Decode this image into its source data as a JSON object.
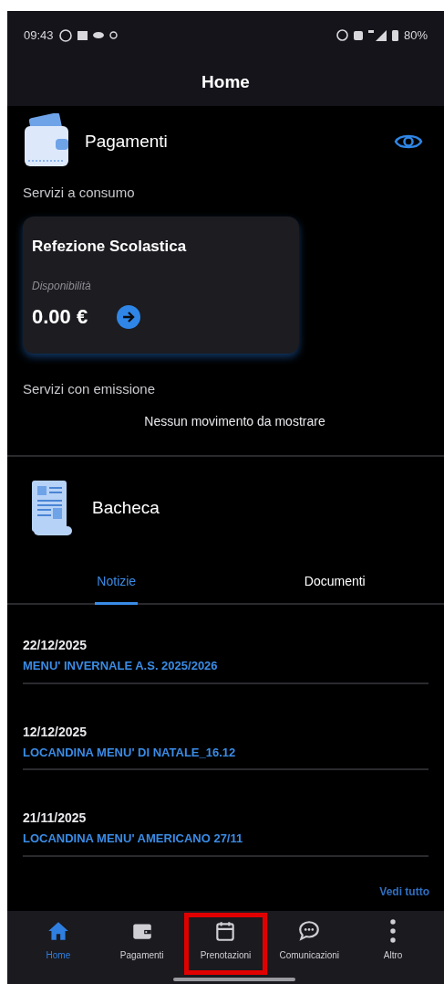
{
  "status_bar": {
    "time": "09:43",
    "battery": "80%"
  },
  "header": {
    "title": "Home"
  },
  "payments": {
    "title": "Pagamenti",
    "consumption_label": "Servizi a consumo",
    "card": {
      "title": "Refezione Scolastica",
      "caption": "Disponibilità",
      "amount": "0.00 €"
    },
    "emission_label": "Servizi con emissione",
    "empty_message": "Nessun movimento da mostrare"
  },
  "board": {
    "title": "Bacheca",
    "tabs": [
      {
        "label": "Notizie",
        "selected": true
      },
      {
        "label": "Documenti",
        "selected": false
      }
    ],
    "news": [
      {
        "date": "22/12/2025",
        "title": "MENU' INVERNALE A.S. 2025/2026"
      },
      {
        "date": "12/12/2025",
        "title": "LOCANDINA MENU' DI NATALE_16.12"
      },
      {
        "date": "21/11/2025",
        "title": "LOCANDINA MENU' AMERICANO 27/11"
      }
    ],
    "see_all": "Vedi tutto"
  },
  "bottom_nav": [
    {
      "kind": "home",
      "label": "Home",
      "selected": true,
      "highlighted": false
    },
    {
      "kind": "wallet",
      "label": "Pagamenti",
      "selected": false,
      "highlighted": false
    },
    {
      "kind": "calendar",
      "label": "Prenotazioni",
      "selected": false,
      "highlighted": true
    },
    {
      "kind": "chat",
      "label": "Comunicazioni",
      "selected": false,
      "highlighted": false
    },
    {
      "kind": "more",
      "label": "Altro",
      "selected": false,
      "highlighted": false
    }
  ]
}
